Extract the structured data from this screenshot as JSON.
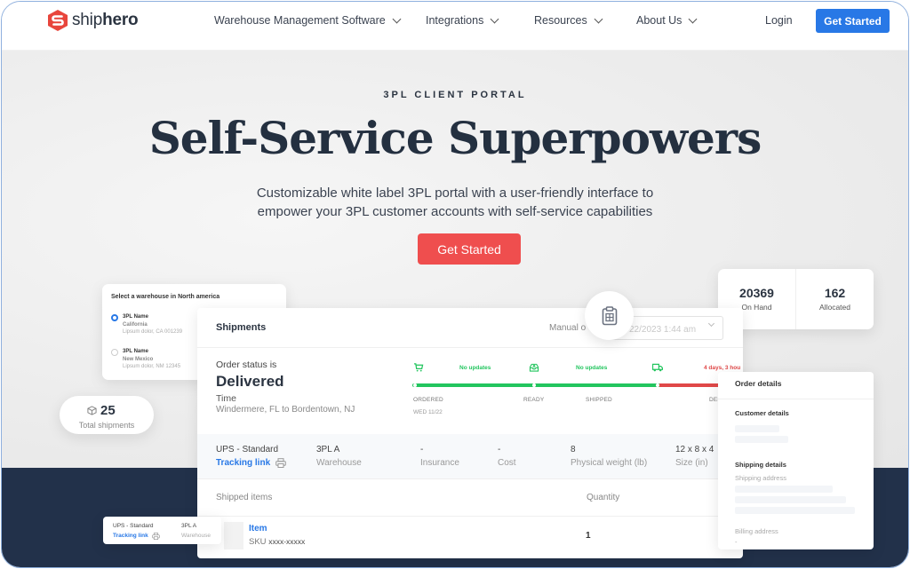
{
  "nav": {
    "brand_light": "ship",
    "brand_bold": "hero",
    "items": [
      {
        "label": "Warehouse Management Software"
      },
      {
        "label": "Integrations"
      },
      {
        "label": "Resources"
      },
      {
        "label": "About Us"
      }
    ],
    "login": "Login",
    "cta": "Get Started"
  },
  "hero": {
    "eyebrow": "3PL CLIENT PORTAL",
    "title": "Self-Service Superpowers",
    "subtitle_line1": "Customizable white label 3PL portal with a user-friendly interface to",
    "subtitle_line2": "empower your 3PL customer accounts with self-service capabilities",
    "cta": "Get Started"
  },
  "warehouse_card": {
    "title": "Select a warehouse in North america",
    "options": [
      {
        "name": "3PL Name",
        "state": "California",
        "address": "Lipsum dolor, CA 001239",
        "selected": true
      },
      {
        "name": "3PL Name",
        "state": "New Mexico",
        "address": "Lipsum dolor, NM 12345",
        "selected": false
      }
    ]
  },
  "stock_card": {
    "on_hand_value": "20369",
    "on_hand_label": "On Hand",
    "allocated_value": "162",
    "allocated_label": "Allocated"
  },
  "shipments": {
    "title": "Shipments",
    "manual_label": "Manual o",
    "date_value": "22/2023 1:44 am",
    "status_label": "Order status is",
    "status_value": "Delivered",
    "time_label": "Time",
    "route": "Windermere, FL to Bordentown, NJ",
    "tracker": {
      "updates": [
        "No updates",
        "No updates"
      ],
      "late_text": "4 days, 3 hou",
      "stages": [
        "ORDERED",
        "READY",
        "SHIPPED",
        "DEL"
      ],
      "ordered_date": "WED 11/22",
      "green_fraction": 0.79,
      "colors": {
        "ok": "#22c55e",
        "late": "#e04848"
      }
    },
    "carrier": {
      "service": "UPS - Standard",
      "tracking_link": "Tracking link",
      "warehouse_value": "3PL A",
      "warehouse_label": "Warehouse",
      "insurance_value": "-",
      "insurance_label": "Insurance",
      "cost_value": "-",
      "cost_label": "Cost",
      "weight_value": "8",
      "weight_label": "Physical weight (lb)",
      "size_value": "12 x 8 x 4",
      "size_label": "Size (in)"
    },
    "items_header": "Shipped items",
    "quantity_header": "Quantity",
    "items": [
      {
        "name": "Item",
        "sku_label": "SKU",
        "sku": "xxxx-xxxxx",
        "quantity": "1"
      }
    ]
  },
  "order_details": {
    "title": "Order details",
    "customer_section": "Customer details",
    "shipping_section": "Shipping details",
    "shipping_address_label": "Shipping address",
    "billing_address_label": "Billing address",
    "billing_value": "-"
  },
  "total_card": {
    "value": "25",
    "label": "Total shipments"
  },
  "mini_card": {
    "service": "UPS - Standard",
    "tracking_link": "Tracking link",
    "warehouse_value": "3PL A",
    "warehouse_label": "Warehouse"
  },
  "colors": {
    "primary_blue": "#2878e6",
    "cta_red": "#ef4e4e",
    "navy": "#22314a",
    "text_dark": "#2b3441"
  }
}
